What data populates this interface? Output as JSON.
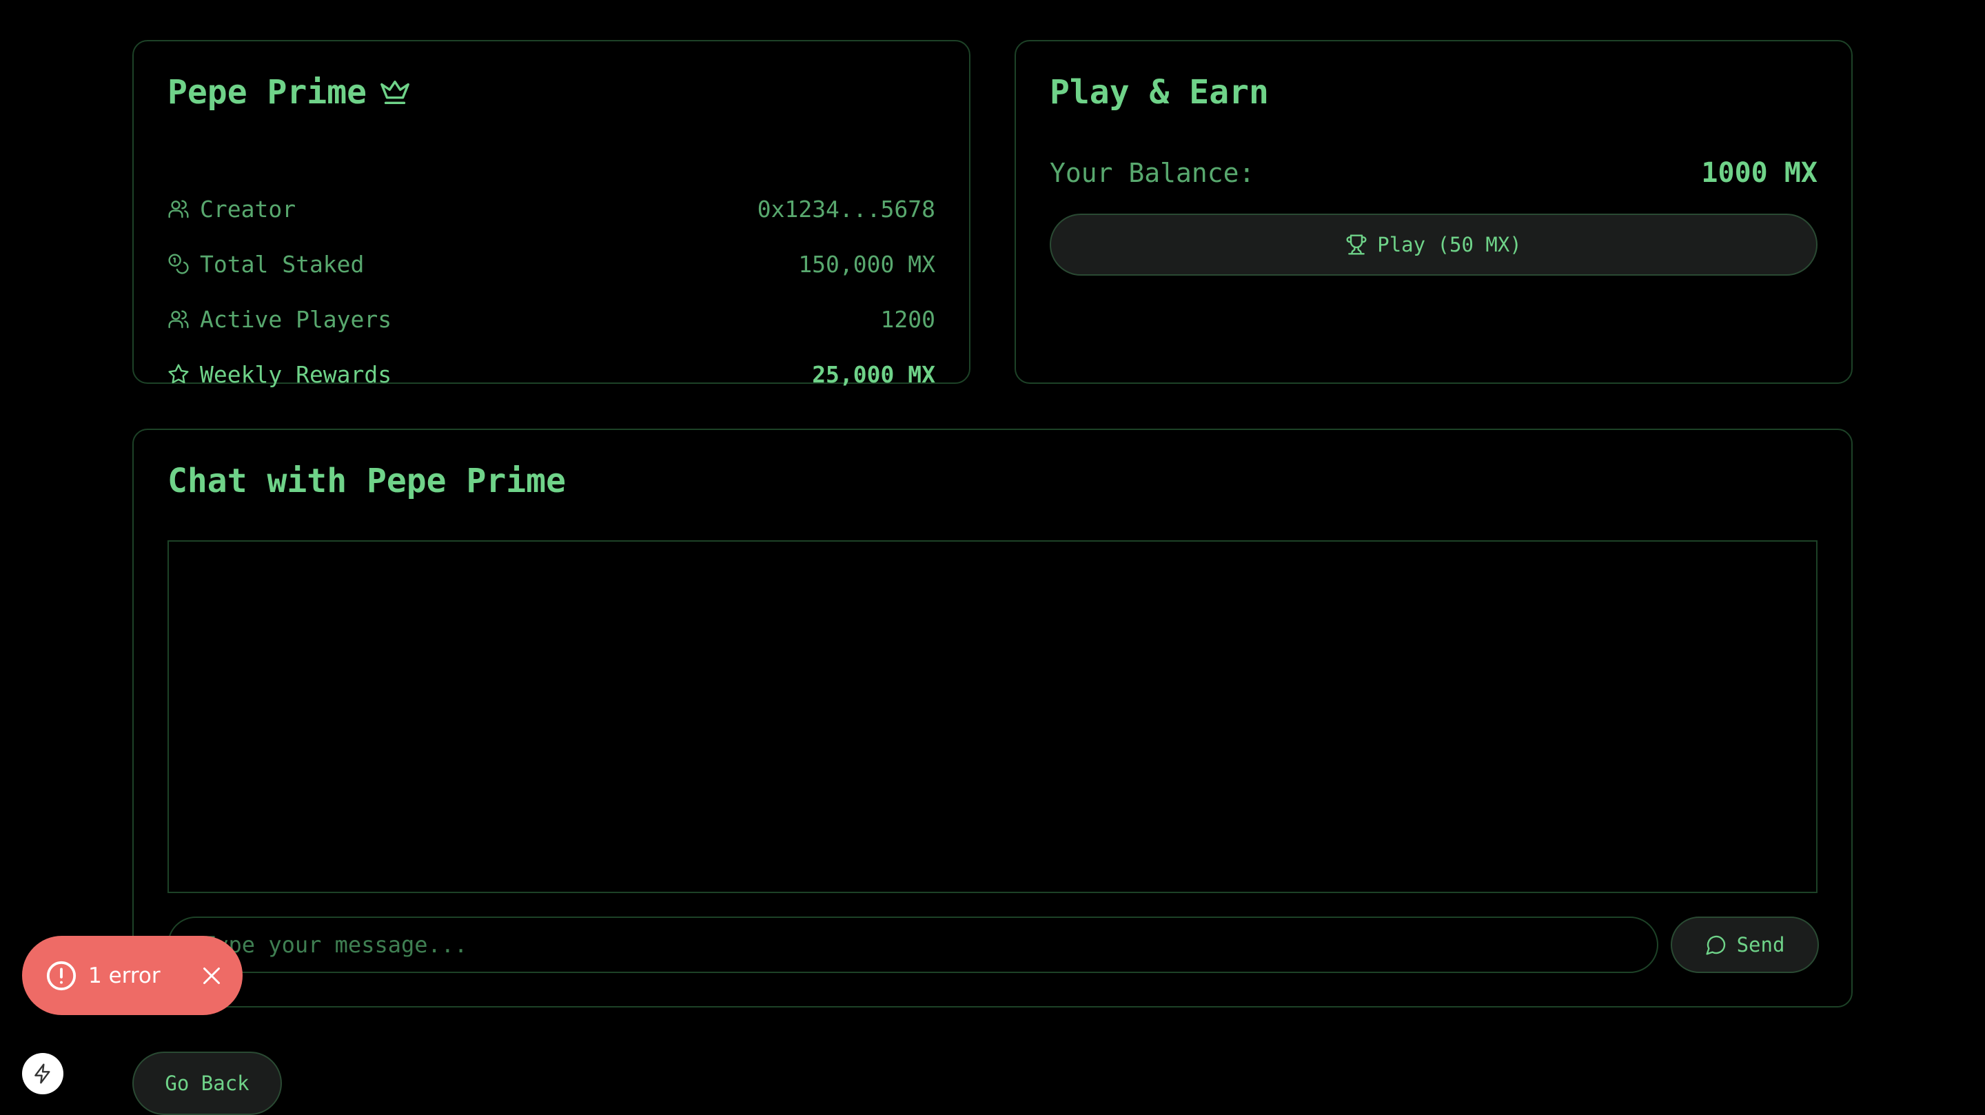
{
  "game": {
    "title": "Pepe Prime",
    "title_icon": "crown-icon",
    "stats": [
      {
        "icon": "users-icon",
        "label": "Creator",
        "value": "0x1234...5678"
      },
      {
        "icon": "coins-icon",
        "label": "Total Staked",
        "value": "150,000 MX"
      },
      {
        "icon": "users-icon",
        "label": "Active Players",
        "value": "1200"
      },
      {
        "icon": "star-icon",
        "label": "Weekly Rewards",
        "value": "25,000 MX"
      }
    ]
  },
  "earn": {
    "title": "Play & Earn",
    "balance_label": "Your Balance:",
    "balance_value": "1000 MX",
    "play_label": "Play (50 MX)",
    "play_icon": "trophy-icon"
  },
  "chat": {
    "title": "Chat with Pepe Prime",
    "input_placeholder": "Type your message...",
    "input_value": "",
    "send_label": "Send",
    "send_icon": "message-circle-icon"
  },
  "nav": {
    "back_label": "Go Back"
  },
  "error_toast": {
    "label": "1 error"
  },
  "colors": {
    "background": "#000000",
    "accent": "#6fd389",
    "muted": "#58a86e",
    "border": "#1d4227",
    "error": "#ee6b66"
  }
}
